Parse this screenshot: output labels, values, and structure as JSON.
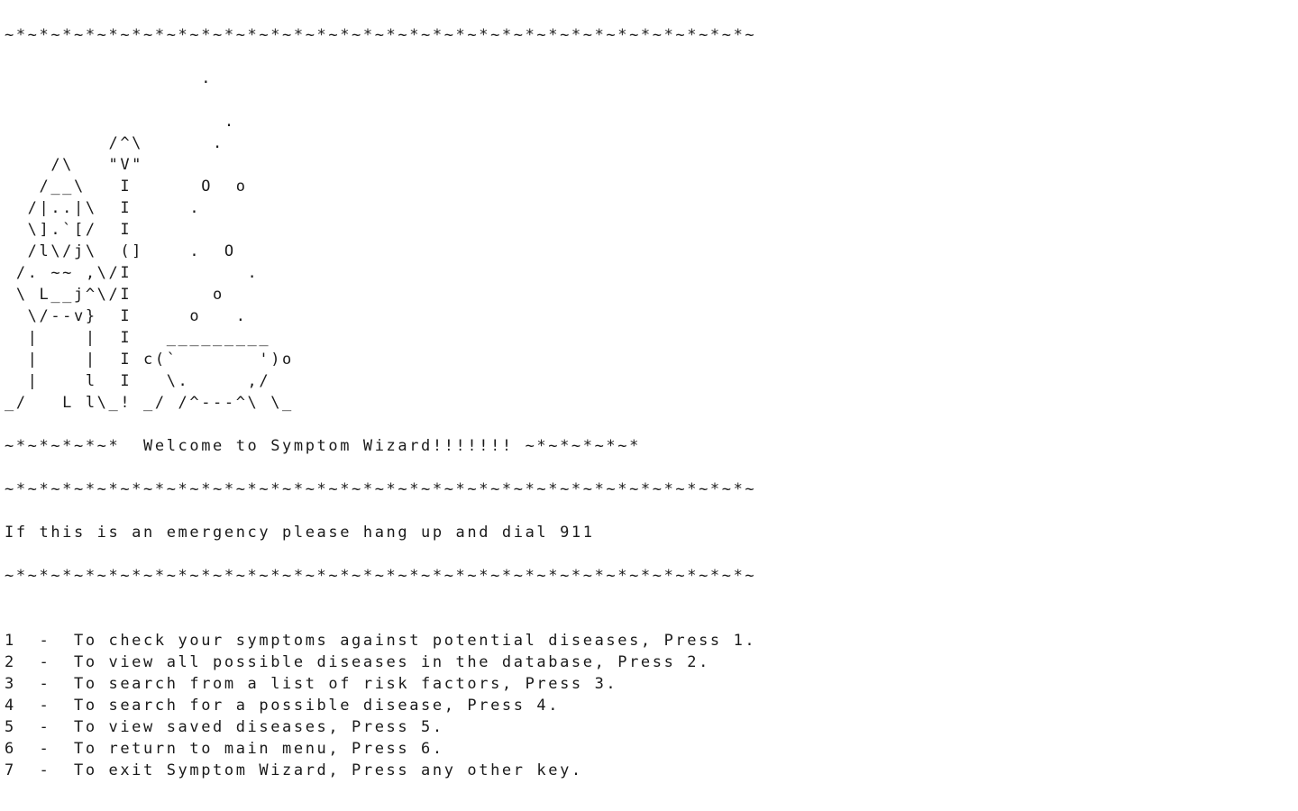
{
  "border": {
    "line": "~*~*~*~*~*~*~*~*~*~*~*~*~*~*~*~*~*~*~*~*~*~*~*~*~*~*~*~*~*~*~*~*~"
  },
  "wizard_art": [
    "                 .",
    "                   .",
    "         /^\\      .",
    "    /\\   \"V\"",
    "   /__\\   I      O  o",
    "  /|..|\\  I     .",
    "  \\].`[/  I",
    "  /l\\/j\\  (]    .  O",
    " /. ~~ ,\\/I          .",
    " \\ L__j^\\/I       o",
    "  \\/--v}  I     o   .",
    "  |    |  I   _________",
    "  |    |  I c(`       ')o",
    "  |    l  I   \\.     ,/",
    "_/   L l\\_! _/ /^---^\\ \\_"
  ],
  "welcome": {
    "text": "~*~*~*~*~*  Welcome to Symptom Wizard!!!!!!! ~*~*~*~*~*"
  },
  "emergency": {
    "text": "If this is an emergency please hang up and dial 911"
  },
  "menu": {
    "items": [
      "1  -  To check your symptoms against potential diseases, Press 1.",
      "2  -  To view all possible diseases in the database, Press 2.",
      "3  -  To search from a list of risk factors, Press 3.",
      "4  -  To search for a possible disease, Press 4.",
      "5  -  To view saved diseases, Press 5.",
      "6  -  To return to main menu, Press 6.",
      "7  -  To exit Symptom Wizard, Press any other key."
    ]
  },
  "colors": {
    "background": "#ffffff",
    "text": "#1a1a1a"
  }
}
